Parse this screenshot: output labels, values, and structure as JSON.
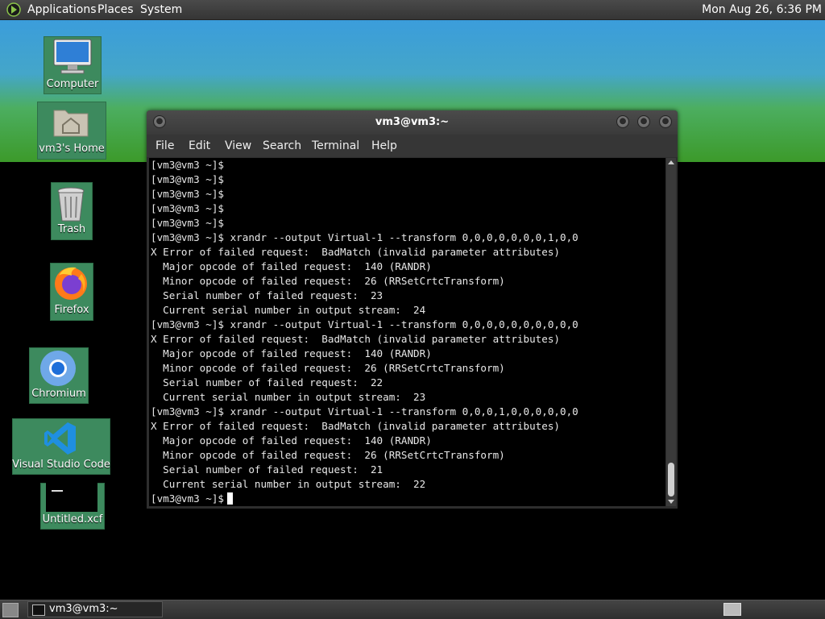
{
  "top_panel": {
    "menus": [
      "Applications",
      "Places",
      "System"
    ],
    "clock": "Mon Aug 26,  6:36 PM"
  },
  "desktop_icons": [
    {
      "label": "Computer",
      "icon": "computer-icon"
    },
    {
      "label": "vm3's Home",
      "icon": "home-folder-icon"
    },
    {
      "label": "Trash",
      "icon": "trash-icon"
    },
    {
      "label": "Firefox",
      "icon": "firefox-icon"
    },
    {
      "label": "Chromium",
      "icon": "chromium-icon"
    },
    {
      "label": "Visual Studio Code",
      "icon": "vscode-icon"
    },
    {
      "label": "Untitled.xcf",
      "icon": "xcf-file-icon"
    }
  ],
  "terminal": {
    "title": "vm3@vm3:~",
    "menus": [
      "File",
      "Edit",
      "View",
      "Search",
      "Terminal",
      "Help"
    ],
    "lines": [
      "[vm3@vm3 ~]$",
      "[vm3@vm3 ~]$",
      "[vm3@vm3 ~]$",
      "[vm3@vm3 ~]$",
      "[vm3@vm3 ~]$",
      "[vm3@vm3 ~]$ xrandr --output Virtual-1 --transform 0,0,0,0,0,0,0,1,0,0",
      "X Error of failed request:  BadMatch (invalid parameter attributes)",
      "  Major opcode of failed request:  140 (RANDR)",
      "  Minor opcode of failed request:  26 (RRSetCrtcTransform)",
      "  Serial number of failed request:  23",
      "  Current serial number in output stream:  24",
      "[vm3@vm3 ~]$ xrandr --output Virtual-1 --transform 0,0,0,0,0,0,0,0,0,0",
      "X Error of failed request:  BadMatch (invalid parameter attributes)",
      "  Major opcode of failed request:  140 (RANDR)",
      "  Minor opcode of failed request:  26 (RRSetCrtcTransform)",
      "  Serial number of failed request:  22",
      "  Current serial number in output stream:  23",
      "[vm3@vm3 ~]$ xrandr --output Virtual-1 --transform 0,0,0,1,0,0,0,0,0,0",
      "X Error of failed request:  BadMatch (invalid parameter attributes)",
      "  Major opcode of failed request:  140 (RANDR)",
      "  Minor opcode of failed request:  26 (RRSetCrtcTransform)",
      "  Serial number of failed request:  21",
      "  Current serial number in output stream:  22"
    ],
    "prompt": "[vm3@vm3 ~]$"
  },
  "taskbar": {
    "task_label": "vm3@vm3:~"
  }
}
